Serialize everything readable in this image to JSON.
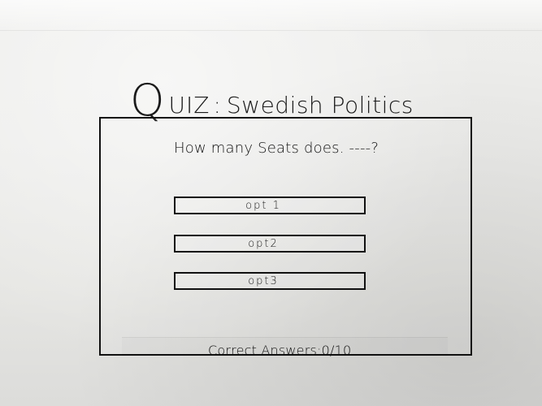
{
  "title": {
    "q": "Q",
    "rest": "UIZ",
    "colon": ":",
    "subject": "Swedish Politics"
  },
  "question": {
    "text": "How many Seats does. ----?"
  },
  "options": [
    {
      "label": "opt 1"
    },
    {
      "label": "opt2"
    },
    {
      "label": "opt3"
    }
  ],
  "score": {
    "text": "Correct Answers:0/10"
  }
}
